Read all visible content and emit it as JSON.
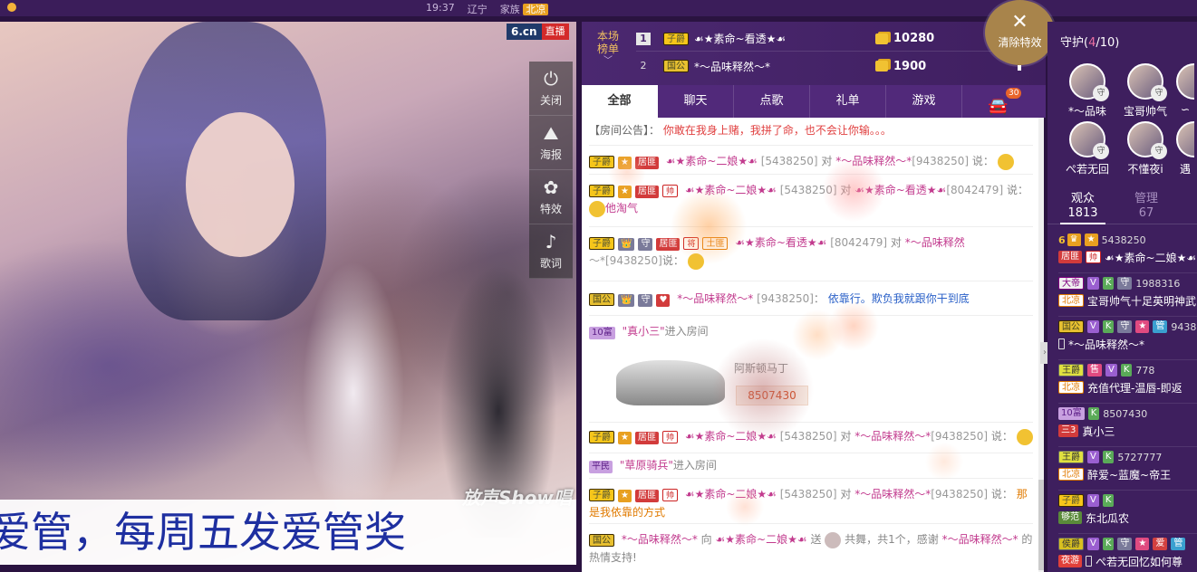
{
  "topbar": {
    "time": "19:37",
    "province": "辽宁",
    "family_label": "家族",
    "family_tag": "北凉"
  },
  "video": {
    "logo": "6.cn",
    "live_tag": "直播",
    "buttons": [
      {
        "icon": "power-icon",
        "label": "关闭"
      },
      {
        "icon": "poster-icon",
        "label": "海报"
      },
      {
        "icon": "effects-icon",
        "label": "特效"
      },
      {
        "icon": "lyrics-icon",
        "label": "歌词"
      }
    ],
    "subtitle": "爱管，每周五发爱管奖",
    "watermark": "放声Show唱"
  },
  "ranking": {
    "tag_line1": "本场",
    "tag_line2": "榜单",
    "rows": [
      {
        "no": "1",
        "badge": "子爵",
        "name": "☙★素命~看透★☙",
        "coins": "10280"
      },
      {
        "no": "2",
        "badge": "国公",
        "name": "*～品味释然～*",
        "coins": "1900"
      }
    ]
  },
  "clear_effects": {
    "label": "清除特效"
  },
  "tabs": [
    {
      "label": "全部",
      "active": true
    },
    {
      "label": "聊天",
      "active": false
    },
    {
      "label": "点歌",
      "active": false
    },
    {
      "label": "礼单",
      "active": false
    },
    {
      "label": "游戏",
      "active": false
    }
  ],
  "car_count": "30",
  "chat": {
    "notice_label": "【房间公告】",
    "notice_text": "你敢在我身上赌，我拼了命，也不会让你输。。。",
    "m1": {
      "badge": "子爵",
      "jv": "居匪",
      "nick": "☙★素命~二娘★☙",
      "uid": "[5438250]",
      "to": "对",
      "target": "*～品味释然～*",
      "tuid": "[9438250]",
      "say": "说："
    },
    "m2": {
      "badge": "子爵",
      "jv": "居匪",
      "nick": "☙★素命~二娘★☙",
      "uid": "[5438250]",
      "to": "对",
      "target": "☙★素命~看透★☙",
      "tuid": "[8042479]",
      "say": "说：",
      "text": "他淘气"
    },
    "m3": {
      "badge": "子爵",
      "jv": "居匪",
      "tag2": "土匪",
      "nick": "☙★素命~看透★☙",
      "uid": "[8042479]",
      "to": "对",
      "target": "*～品味释然",
      "tuid": "～*[9438250]",
      "say": "说："
    },
    "m4": {
      "badge": "国公",
      "nick": "*～品味释然～*",
      "uid": "[9438250]",
      "say": "：",
      "text": "依靠行。欺负我就跟你干到底"
    },
    "m5": {
      "badge": "10富",
      "name": "\"真小三\"",
      "action": "进入房间"
    },
    "car": {
      "brand": "阿斯顿马丁",
      "num": "8507430"
    },
    "m6": {
      "badge": "子爵",
      "jv": "居匪",
      "nick": "☙★素命~二娘★☙",
      "uid": "[5438250]",
      "to": "对",
      "target": "*～品味释然～*",
      "tuid": "[9438250]",
      "say": "说："
    },
    "m7": {
      "badge": "平民",
      "name": "\"草原骑兵\"",
      "action": "进入房间"
    },
    "m8": {
      "badge": "子爵",
      "jv": "居匪",
      "nick": "☙★素命~二娘★☙",
      "uid": "[5438250]",
      "to": "对",
      "target": "*～品味释然～*",
      "tuid": "[9438250]",
      "say": "说：",
      "text": "那是我依靠的方式"
    },
    "m9": {
      "badge": "国公",
      "nick": "*～品味释然～*",
      "dir": "向",
      "target": "☙★素命~二娘★☙",
      "send": "送",
      "gift": "共舞，共1个，感谢",
      "thanks": "*～品味释然～*",
      "tail": "的热情支持!"
    }
  },
  "guard": {
    "title": "守护",
    "current": "4",
    "total": "/10",
    "items": [
      {
        "name": "*～品味"
      },
      {
        "name": "宝哥帅气"
      },
      {
        "name": "∽"
      },
      {
        "name": "ぺ若无回"
      },
      {
        "name": "不懂夜i"
      },
      {
        "name": "遇"
      }
    ]
  },
  "audience": {
    "tab1_label": "观众",
    "tab1_count": "1813",
    "tab2_label": "管理",
    "tab2_count": "67",
    "users": [
      {
        "rank": "6",
        "id": "5438250",
        "badge": "居匪",
        "name": "☙★素命~二娘★☙"
      },
      {
        "badge": "大帝",
        "id": "1988316",
        "badge2": "北凉",
        "name": "宝哥帅气十足英明神武"
      },
      {
        "badge": "国公",
        "id": "9438",
        "name": "*～品味释然～*"
      },
      {
        "badge": "王爵",
        "id": "778",
        "badge2": "北凉",
        "name": "充值代理-温唇-即返"
      },
      {
        "badge": "10富",
        "id": "8507430",
        "badge2": "三3",
        "name": "真小三"
      },
      {
        "badge": "王爵",
        "id": "5727777",
        "badge2": "北凉",
        "name": "醉爱~蓝魔~帝王"
      },
      {
        "badge": "子爵",
        "id": "",
        "badge2": "够范",
        "name": "东北瓜农"
      },
      {
        "badge": "侯爵",
        "id": "",
        "badge2": "夜游",
        "name": "ぺ若无回忆如何尊"
      }
    ]
  },
  "colors": {
    "panel_purple": "#51297a",
    "accent_gold": "#a8844b",
    "nick_pink": "#c23b8e"
  }
}
